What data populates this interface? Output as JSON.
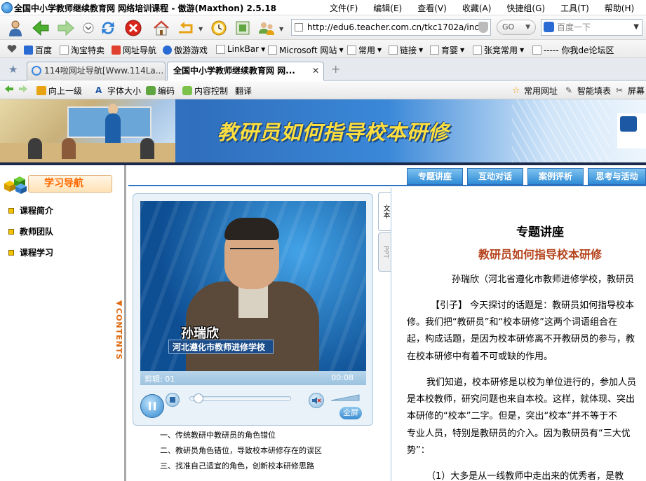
{
  "window": {
    "title": "全国中小学教师继续教育网 网络培训课程 - 傲游(Maxthon) 2.5.18",
    "menu": [
      "文件(F)",
      "编辑(E)",
      "查看(V)",
      "收藏(A)",
      "快捷组(G)",
      "工具(T)",
      "帮助(H)"
    ]
  },
  "navbar": {
    "address": "http://edu6.teacher.com.cn/tkc1702a/inc",
    "go_label": "GO",
    "search_placeholder": "百度一下"
  },
  "favorites": [
    "百度",
    "淘宝特卖",
    "网址导航",
    "傲游游戏",
    "LinkBar",
    "Microsoft 网站",
    "常用",
    "链接",
    "育婴",
    "张竞常用",
    "----- 你我de论坛区"
  ],
  "tabs": [
    {
      "label": "114啦网址导航[Www.114La...",
      "active": false
    },
    {
      "label": "全国中小学教师继续教育网 网...",
      "active": true
    }
  ],
  "page_toolbar": {
    "up": "向上一级",
    "font": "字体大小",
    "encoding": "编码",
    "content_control": "内容控制",
    "translate": "翻译",
    "common_urls": "常用网址",
    "smart_fill": "智能填表",
    "screenshot": "屏幕"
  },
  "banner": {
    "heading": "教研员如何指导校本研修"
  },
  "left_nav": {
    "header": "学习导航",
    "items": [
      "课程简介",
      "教师团队",
      "课程学习"
    ],
    "contents_label": "CONTENTS"
  },
  "top_tabs": [
    "专题讲座",
    "互动对话",
    "案例评析",
    "思考与活动"
  ],
  "player": {
    "caption_name": "孙瑞欣",
    "caption_school": "河北遵化市教师进修学校",
    "time_left": "剪辑: 01",
    "time_right": "00:08",
    "fullscreen": "全屏",
    "progress": 0.02
  },
  "chapters": [
    "一、传统教研中教研员的角色错位",
    "二、教研员角色错位，导致校本研修存在的误区",
    "三、找准自己适宜的角色，创新校本研修思路"
  ],
  "side_tabs": [
    "文本",
    "PPT"
  ],
  "article": {
    "title": "专题讲座",
    "subtitle": "教研员如何指导校本研修",
    "author": "孙瑞欣（河北省遵化市教师进修学校，教研员",
    "lines": [
      "【引子】 今天探讨的话题是：教研员如何指导校本",
      "修。我们把“教研员”和“校本研修”这两个词语组合在",
      "起，构成话题，是因为校本研修离不开教研员的参与，教",
      "在校本研修中有着不可或缺的作用。",
      "我们知道，校本研修是以校为单位进行的，参加人员",
      "是本校教师，研究问题也来自本校。这样，就体现、突出",
      "本研修的“校本”二字。但是，突出“校本”并不等于不",
      "专业人员，特别是教研员的介入。因为教研员有“三大优",
      "势”：",
      "（1）大多是从一线教师中走出来的优秀者，是教"
    ]
  }
}
